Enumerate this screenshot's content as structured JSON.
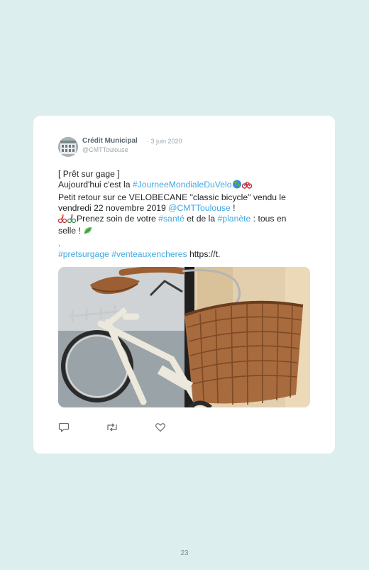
{
  "tweet": {
    "author": "Crédit Municipal",
    "separator": " · ",
    "date": "3 juin 2020",
    "handle": "@CMTToulouse",
    "line1": "[ Prêt sur gage ]",
    "line2_a": "Aujourd'hui c'est la ",
    "hashtag_journee": "#JourneeMondialeDuVelo",
    "line3": "Petit retour sur ce VELOBECANE \"classic bicycle\" vendu le",
    "line4_a": "vendredi 22 novembre 2019 ",
    "mention": "@CMTToulouse",
    "line4_b": " !",
    "line5_a": "Prenez soin de votre ",
    "hashtag_sante": "#santé",
    "line5_b": " et de la ",
    "hashtag_planete": "#planète",
    "line5_c": " : tous en",
    "line6": "selle ! ",
    "dot": ".",
    "hashtag_pret": "#pretsurgage",
    "hashtag_vente": "#venteauxencheres",
    "link": " https://t."
  },
  "icons": {
    "reply": "reply-icon",
    "retweet": "retweet-icon",
    "like": "like-icon",
    "globe": "globe-emoji-icon",
    "bike": "bike-emoji-icon",
    "cyclists": "cyclists-emoji-icon",
    "leaf": "leaf-emoji-icon"
  },
  "colors": {
    "background": "#dceeed",
    "hashtag": "#3fa9e0",
    "basket": "#a86b3e"
  },
  "page": {
    "number": "23"
  }
}
